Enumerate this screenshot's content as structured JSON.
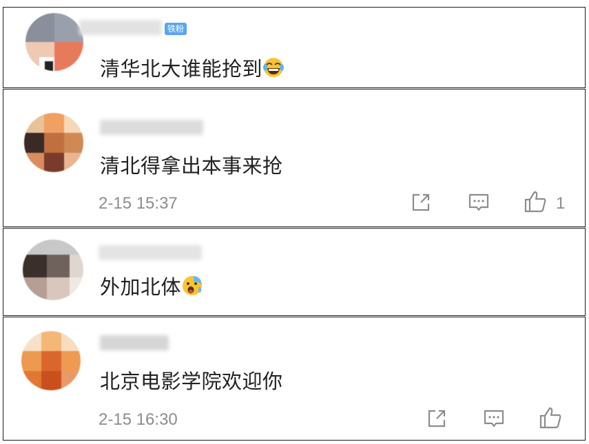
{
  "comments": [
    {
      "text": "清华北大谁能抢到",
      "emoji": "laugh-cry-emoji",
      "badge": "铁粉",
      "timestamp": "",
      "like_count": ""
    },
    {
      "text": "清北得拿出本事来抢",
      "emoji": "",
      "badge": "",
      "timestamp": "2-15 15:37",
      "like_count": "1"
    },
    {
      "text": "外加北体",
      "emoji": "sweat-shocked-emoji",
      "badge": "",
      "timestamp": "",
      "like_count": ""
    },
    {
      "text": "北京电影学院欢迎你",
      "emoji": "",
      "badge": "",
      "timestamp": "2-15 16:30",
      "like_count": ""
    }
  ],
  "icons": {
    "share": "share-icon",
    "reply": "comment-icon",
    "like": "thumbs-up-icon"
  },
  "colors": {
    "text": "#222222",
    "meta": "#8c8c8c",
    "badge": "#5aa6ef",
    "border": "#1c1c1c"
  }
}
